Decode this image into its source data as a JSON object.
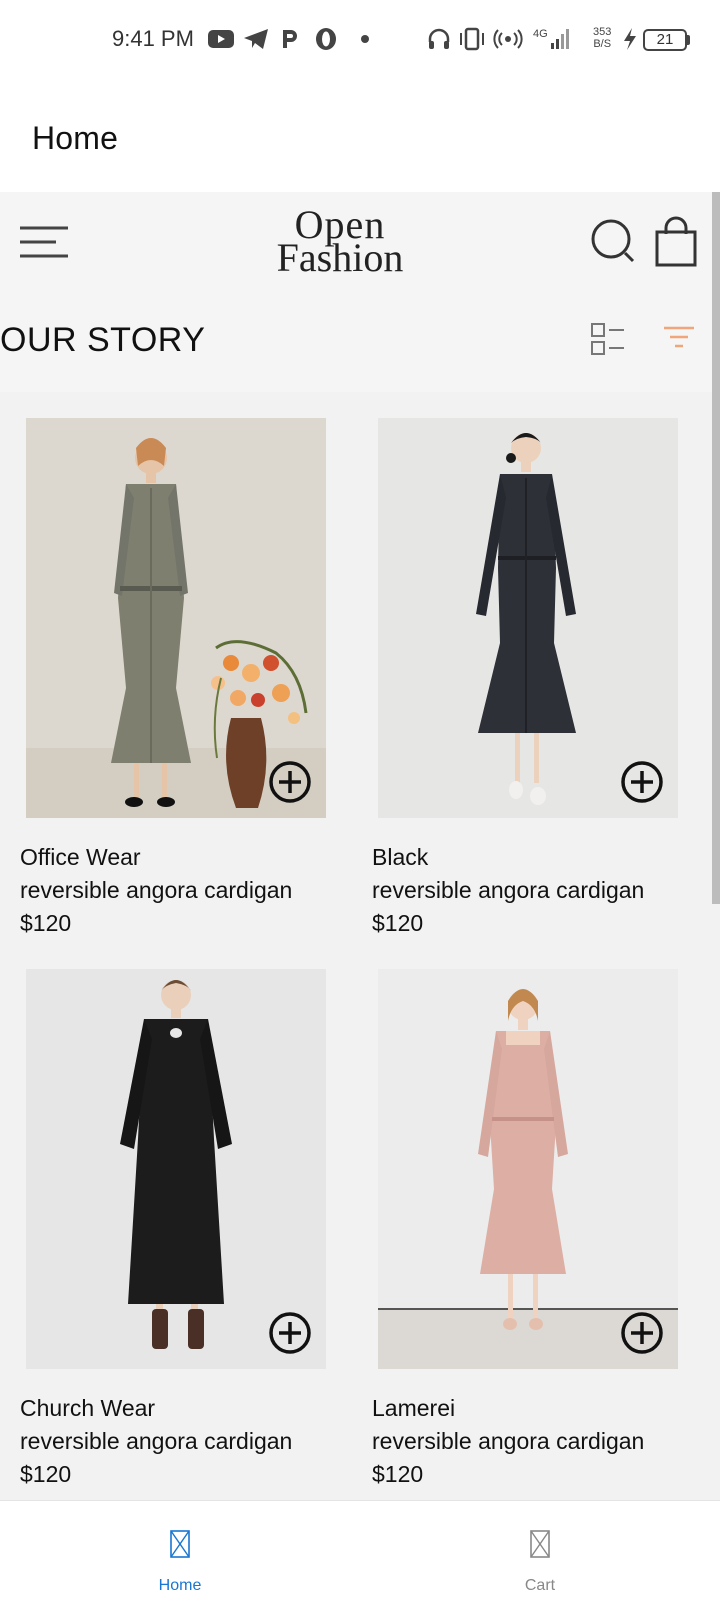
{
  "status_bar": {
    "time": "9:41 PM",
    "network_speed_top": "353",
    "network_speed_bottom": "B/S",
    "network_type": "4G",
    "battery": "21"
  },
  "app_header": {
    "title": "Home"
  },
  "topbar": {
    "logo_line1": "Open",
    "logo_line2": "Fashion",
    "section_title": "OUR STORY",
    "icons": [
      "menu-icon",
      "search-icon",
      "shopping-bag-icon",
      "list-view-icon",
      "filter-icon"
    ],
    "accent_color": "#f0a57a"
  },
  "products": [
    {
      "name": "Office Wear",
      "description": "reversible angora cardigan",
      "price": "$120"
    },
    {
      "name": "Black",
      "description": "reversible angora cardigan",
      "price": "$120"
    },
    {
      "name": "Church Wear",
      "description": "reversible angora cardigan",
      "price": "$120"
    },
    {
      "name": "Lamerei",
      "description": "reversible angora cardigan",
      "price": "$120"
    }
  ],
  "bottom_nav": {
    "items": [
      {
        "label": "Home",
        "active": true
      },
      {
        "label": "Cart",
        "active": false
      }
    ],
    "active_color": "#1976d2",
    "inactive_color": "#888888"
  }
}
